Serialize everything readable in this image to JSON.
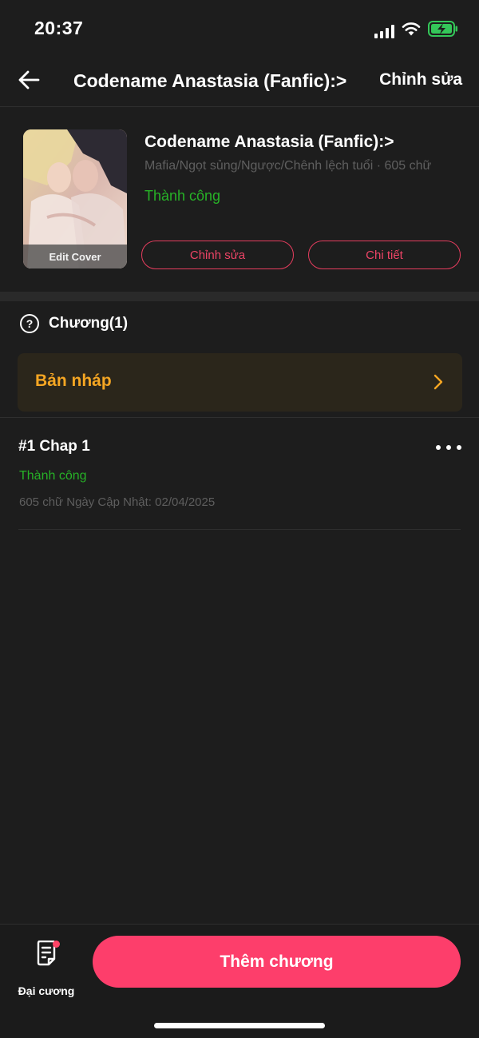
{
  "status_bar": {
    "time": "20:37"
  },
  "nav": {
    "title": "Codename Anastasia (Fanfic):>",
    "edit_label": "Chỉnh sửa"
  },
  "book": {
    "title": "Codename Anastasia (Fanfic):>",
    "tags": "Mafia/Ngọt sủng/Ngược/Chênh lệch tuổi · 605 chữ",
    "status": "Thành công",
    "cover_label": "Edit Cover",
    "edit_button": "Chỉnh sửa",
    "detail_button": "Chi tiết"
  },
  "chapters": {
    "header": "Chương(1)",
    "draft_label": "Bản nháp",
    "items": [
      {
        "title": "#1 Chap 1",
        "status": "Thành công",
        "meta": "605 chữ Ngày Cập Nhật: 02/04/2025"
      }
    ]
  },
  "bottom_bar": {
    "outline_label": "Đại cương",
    "add_chapter_label": "Thêm chương"
  },
  "colors": {
    "background": "#1d1d1d",
    "accent": "#fd3e6b",
    "success": "#27b227",
    "draft": "#f5a623",
    "battery": "#34c759"
  }
}
